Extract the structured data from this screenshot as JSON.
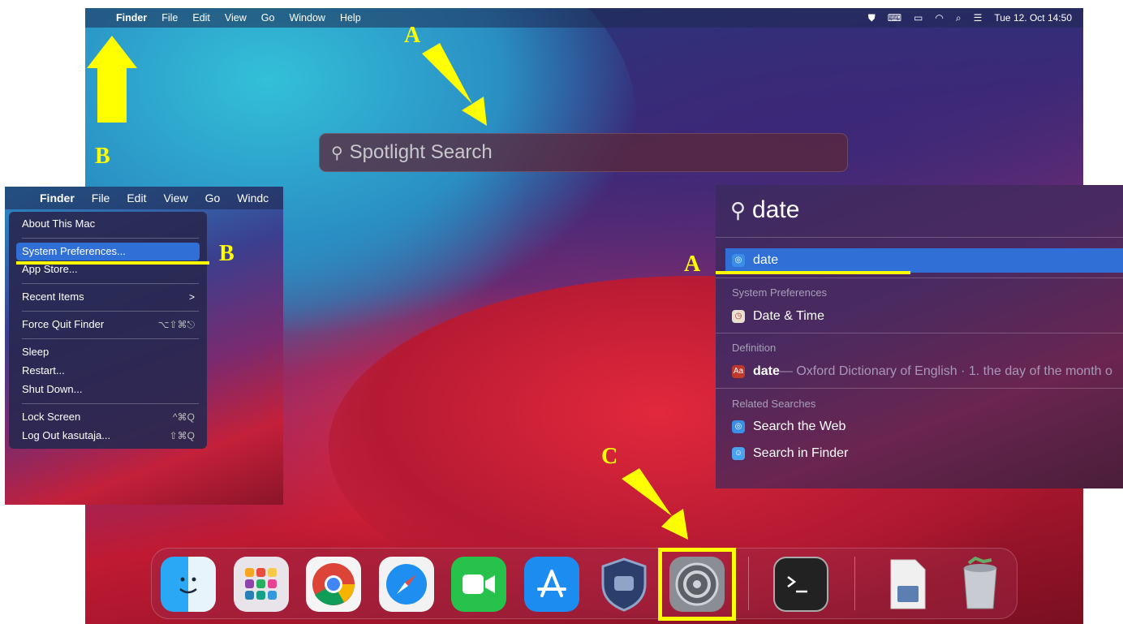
{
  "menubar": {
    "app": "Finder",
    "items": [
      "File",
      "Edit",
      "View",
      "Go",
      "Window",
      "Help"
    ],
    "datetime": "Tue 12. Oct  14:50"
  },
  "spotlight": {
    "placeholder": "Spotlight Search"
  },
  "inset_menubar": {
    "app": "Finder",
    "items": [
      "File",
      "Edit",
      "View",
      "Go",
      "Windc"
    ]
  },
  "apple_menu": {
    "about": "About This Mac",
    "system_prefs": "System Preferences...",
    "app_store": "App Store...",
    "recent": "Recent Items",
    "force_quit": "Force Quit Finder",
    "force_quit_sc": "⌥⇧⌘⎋",
    "sleep": "Sleep",
    "restart": "Restart...",
    "shutdown": "Shut Down...",
    "lock": "Lock Screen",
    "lock_sc": "^⌘Q",
    "logout": "Log Out kasutaja...",
    "logout_sc": "⇧⌘Q",
    "submenu_chevron": ">"
  },
  "results": {
    "query": "date",
    "top_hit": "date",
    "sec_sysprefs": "System Preferences",
    "date_time": "Date & Time",
    "sec_definition": "Definition",
    "def_word": "date",
    "def_text": " — Oxford Dictionary of English · 1. the day of the month o",
    "sec_related": "Related Searches",
    "search_web": "Search the Web",
    "search_finder": "Search in Finder"
  },
  "annotations": {
    "a": "A",
    "b": "B",
    "c": "C"
  },
  "colors": {
    "highlight": "#ffff00",
    "selection": "#2f6fd6"
  }
}
